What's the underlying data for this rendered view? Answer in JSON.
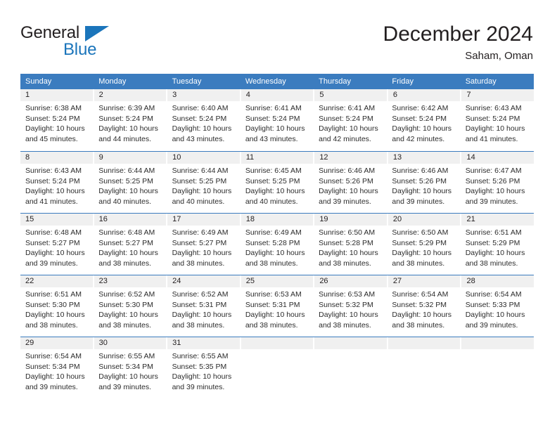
{
  "brand": {
    "name_top": "General",
    "name_bottom": "Blue",
    "flag_icon": "triangle-flag-icon",
    "color_top": "#231f20",
    "color_bottom": "#1b75bb"
  },
  "header": {
    "title": "December 2024",
    "subtitle": "Saham, Oman"
  },
  "theme": {
    "header_blue": "#3b7cbf",
    "daynum_band": "#f0f0f0",
    "text": "#231f20"
  },
  "calendar": {
    "weekdays": [
      "Sunday",
      "Monday",
      "Tuesday",
      "Wednesday",
      "Thursday",
      "Friday",
      "Saturday"
    ],
    "weeks": [
      [
        {
          "day": "1",
          "lines": [
            "Sunrise: 6:38 AM",
            "Sunset: 5:24 PM",
            "Daylight: 10 hours",
            "and 45 minutes."
          ]
        },
        {
          "day": "2",
          "lines": [
            "Sunrise: 6:39 AM",
            "Sunset: 5:24 PM",
            "Daylight: 10 hours",
            "and 44 minutes."
          ]
        },
        {
          "day": "3",
          "lines": [
            "Sunrise: 6:40 AM",
            "Sunset: 5:24 PM",
            "Daylight: 10 hours",
            "and 43 minutes."
          ]
        },
        {
          "day": "4",
          "lines": [
            "Sunrise: 6:41 AM",
            "Sunset: 5:24 PM",
            "Daylight: 10 hours",
            "and 43 minutes."
          ]
        },
        {
          "day": "5",
          "lines": [
            "Sunrise: 6:41 AM",
            "Sunset: 5:24 PM",
            "Daylight: 10 hours",
            "and 42 minutes."
          ]
        },
        {
          "day": "6",
          "lines": [
            "Sunrise: 6:42 AM",
            "Sunset: 5:24 PM",
            "Daylight: 10 hours",
            "and 42 minutes."
          ]
        },
        {
          "day": "7",
          "lines": [
            "Sunrise: 6:43 AM",
            "Sunset: 5:24 PM",
            "Daylight: 10 hours",
            "and 41 minutes."
          ]
        }
      ],
      [
        {
          "day": "8",
          "lines": [
            "Sunrise: 6:43 AM",
            "Sunset: 5:24 PM",
            "Daylight: 10 hours",
            "and 41 minutes."
          ]
        },
        {
          "day": "9",
          "lines": [
            "Sunrise: 6:44 AM",
            "Sunset: 5:25 PM",
            "Daylight: 10 hours",
            "and 40 minutes."
          ]
        },
        {
          "day": "10",
          "lines": [
            "Sunrise: 6:44 AM",
            "Sunset: 5:25 PM",
            "Daylight: 10 hours",
            "and 40 minutes."
          ]
        },
        {
          "day": "11",
          "lines": [
            "Sunrise: 6:45 AM",
            "Sunset: 5:25 PM",
            "Daylight: 10 hours",
            "and 40 minutes."
          ]
        },
        {
          "day": "12",
          "lines": [
            "Sunrise: 6:46 AM",
            "Sunset: 5:26 PM",
            "Daylight: 10 hours",
            "and 39 minutes."
          ]
        },
        {
          "day": "13",
          "lines": [
            "Sunrise: 6:46 AM",
            "Sunset: 5:26 PM",
            "Daylight: 10 hours",
            "and 39 minutes."
          ]
        },
        {
          "day": "14",
          "lines": [
            "Sunrise: 6:47 AM",
            "Sunset: 5:26 PM",
            "Daylight: 10 hours",
            "and 39 minutes."
          ]
        }
      ],
      [
        {
          "day": "15",
          "lines": [
            "Sunrise: 6:48 AM",
            "Sunset: 5:27 PM",
            "Daylight: 10 hours",
            "and 39 minutes."
          ]
        },
        {
          "day": "16",
          "lines": [
            "Sunrise: 6:48 AM",
            "Sunset: 5:27 PM",
            "Daylight: 10 hours",
            "and 38 minutes."
          ]
        },
        {
          "day": "17",
          "lines": [
            "Sunrise: 6:49 AM",
            "Sunset: 5:27 PM",
            "Daylight: 10 hours",
            "and 38 minutes."
          ]
        },
        {
          "day": "18",
          "lines": [
            "Sunrise: 6:49 AM",
            "Sunset: 5:28 PM",
            "Daylight: 10 hours",
            "and 38 minutes."
          ]
        },
        {
          "day": "19",
          "lines": [
            "Sunrise: 6:50 AM",
            "Sunset: 5:28 PM",
            "Daylight: 10 hours",
            "and 38 minutes."
          ]
        },
        {
          "day": "20",
          "lines": [
            "Sunrise: 6:50 AM",
            "Sunset: 5:29 PM",
            "Daylight: 10 hours",
            "and 38 minutes."
          ]
        },
        {
          "day": "21",
          "lines": [
            "Sunrise: 6:51 AM",
            "Sunset: 5:29 PM",
            "Daylight: 10 hours",
            "and 38 minutes."
          ]
        }
      ],
      [
        {
          "day": "22",
          "lines": [
            "Sunrise: 6:51 AM",
            "Sunset: 5:30 PM",
            "Daylight: 10 hours",
            "and 38 minutes."
          ]
        },
        {
          "day": "23",
          "lines": [
            "Sunrise: 6:52 AM",
            "Sunset: 5:30 PM",
            "Daylight: 10 hours",
            "and 38 minutes."
          ]
        },
        {
          "day": "24",
          "lines": [
            "Sunrise: 6:52 AM",
            "Sunset: 5:31 PM",
            "Daylight: 10 hours",
            "and 38 minutes."
          ]
        },
        {
          "day": "25",
          "lines": [
            "Sunrise: 6:53 AM",
            "Sunset: 5:31 PM",
            "Daylight: 10 hours",
            "and 38 minutes."
          ]
        },
        {
          "day": "26",
          "lines": [
            "Sunrise: 6:53 AM",
            "Sunset: 5:32 PM",
            "Daylight: 10 hours",
            "and 38 minutes."
          ]
        },
        {
          "day": "27",
          "lines": [
            "Sunrise: 6:54 AM",
            "Sunset: 5:32 PM",
            "Daylight: 10 hours",
            "and 38 minutes."
          ]
        },
        {
          "day": "28",
          "lines": [
            "Sunrise: 6:54 AM",
            "Sunset: 5:33 PM",
            "Daylight: 10 hours",
            "and 39 minutes."
          ]
        }
      ],
      [
        {
          "day": "29",
          "lines": [
            "Sunrise: 6:54 AM",
            "Sunset: 5:34 PM",
            "Daylight: 10 hours",
            "and 39 minutes."
          ]
        },
        {
          "day": "30",
          "lines": [
            "Sunrise: 6:55 AM",
            "Sunset: 5:34 PM",
            "Daylight: 10 hours",
            "and 39 minutes."
          ]
        },
        {
          "day": "31",
          "lines": [
            "Sunrise: 6:55 AM",
            "Sunset: 5:35 PM",
            "Daylight: 10 hours",
            "and 39 minutes."
          ]
        },
        {
          "day": "",
          "lines": []
        },
        {
          "day": "",
          "lines": []
        },
        {
          "day": "",
          "lines": []
        },
        {
          "day": "",
          "lines": []
        }
      ]
    ]
  }
}
